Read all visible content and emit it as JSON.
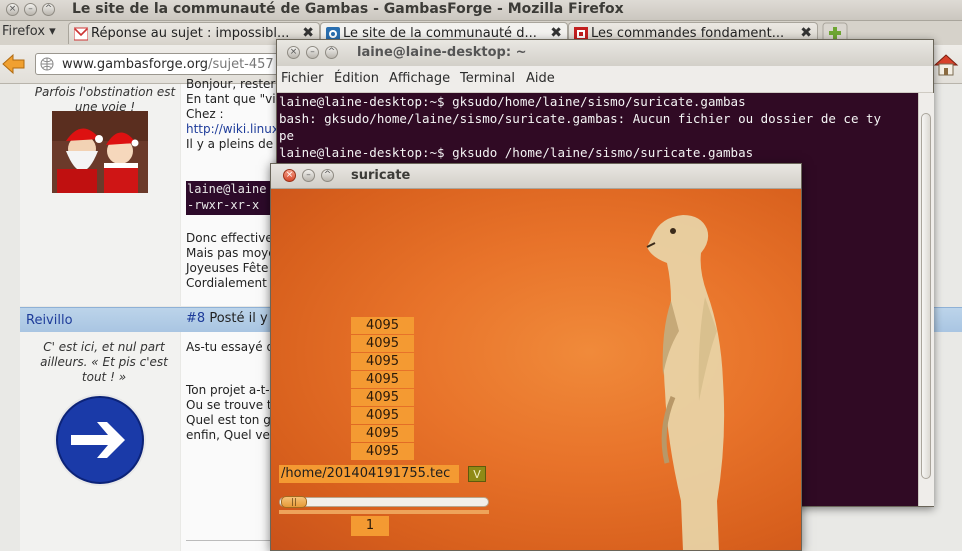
{
  "firefox": {
    "window_title": "Le site de la communauté de Gambas - GambasForge - Mozilla Firefox",
    "menu_button": "Firefox ▾",
    "tabs": [
      {
        "label": "Réponse au sujet : impossibl...",
        "active": false
      },
      {
        "label": "Le site de la communauté d...",
        "active": true
      },
      {
        "label": "Les commandes fondament...",
        "active": false
      }
    ],
    "url_host": "www.gambasforge.org",
    "url_path": "/sujet-457"
  },
  "forum": {
    "post1": {
      "tagline": "Parfois l'obstination est une voie !",
      "lines": [
        "Bonjour, rester",
        "En tant que \"vie",
        "Chez :",
        "http://wiki.linux",
        "Il y a pleins de"
      ],
      "code": [
        "laine@laine",
        "-rwxr-xr-x"
      ],
      "footer": [
        "Donc effective",
        "Mais pas moye",
        "Joyeuses Fête",
        "Cordialement I"
      ]
    },
    "post2": {
      "author": "Reivillo",
      "post_number": "#8",
      "posted": "Posté il y a",
      "tagline": "C' est ici, et nul part ailleurs. « Et pis c'est tout ! »",
      "lines": [
        "As-tu essayé d",
        "Ton projet a-t-i",
        "Ou se trouve t",
        "Quel est ton g",
        "enfin, Quel ver"
      ]
    }
  },
  "terminal": {
    "title": "laine@laine-desktop: ~",
    "menu": [
      "Fichier",
      "Édition",
      "Affichage",
      "Terminal",
      "Aide"
    ],
    "lines": [
      "laine@laine-desktop:~$ gksudo/home/laine/sismo/suricate.gambas",
      "bash: gksudo/home/laine/sismo/suricate.gambas: Aucun fichier ou dossier de ce ty",
      "pe",
      "laine@laine-desktop:~$ gksudo /home/laine/sismo/suricate.gambas"
    ]
  },
  "suricate": {
    "title": "suricate",
    "values": [
      "4095",
      "4095",
      "4095",
      "4095",
      "4095",
      "4095",
      "4095",
      "4095"
    ],
    "file_path": "/home/201404191755.tec",
    "v_button": "V",
    "counter": "1"
  }
}
